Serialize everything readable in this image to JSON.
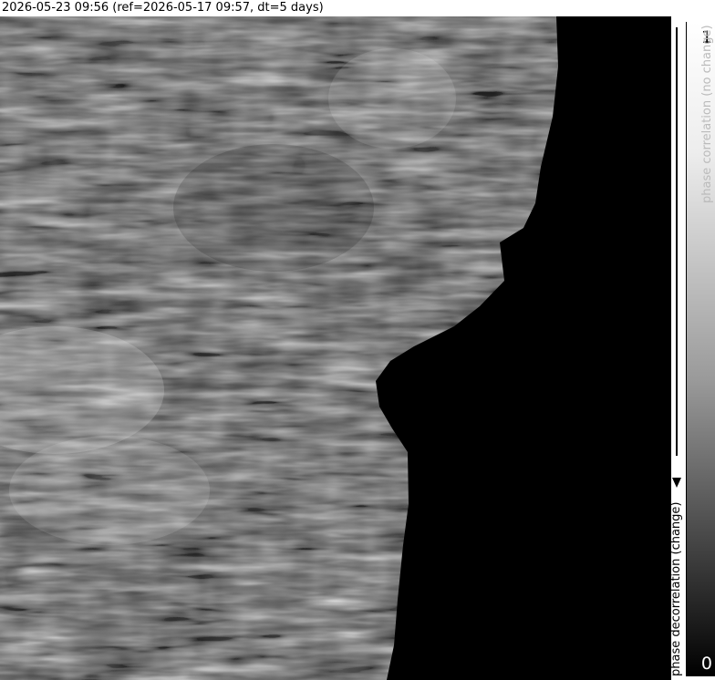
{
  "header": {
    "title": "2026-05-23 09:56 (ref=2026-05-17 09:57, dt=5 days)"
  },
  "colorbar": {
    "max_label": "1",
    "min_label": "0",
    "top_label": "phase correlation (no change)",
    "bottom_label": "phase decorrelation (change)"
  },
  "colors": {
    "background": "#000000",
    "bar_top": "#ffffff",
    "bar_bottom": "#000000"
  }
}
